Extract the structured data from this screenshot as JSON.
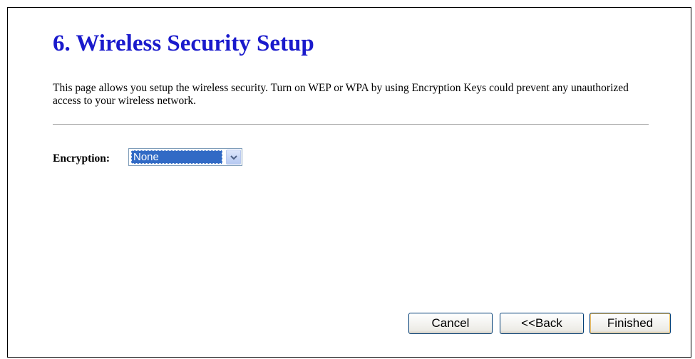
{
  "page": {
    "title": "6. Wireless Security Setup",
    "description": "This page allows you setup the wireless security. Turn on WEP or WPA by using Encryption Keys could prevent any unauthorized access to your wireless network."
  },
  "form": {
    "encryption_label": "Encryption:",
    "encryption_value": "None"
  },
  "buttons": {
    "cancel_label": "Cancel",
    "back_label": "<<Back",
    "finished_label": "Finished"
  },
  "colors": {
    "title": "#1a1acc",
    "select_highlight": "#316ac5"
  },
  "icons": {
    "select_arrow": "chevron-down-icon"
  }
}
